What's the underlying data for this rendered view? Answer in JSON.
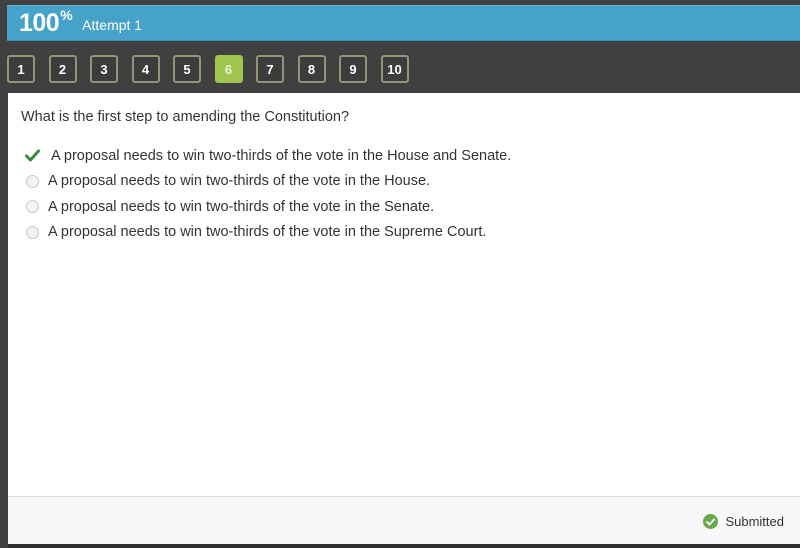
{
  "header": {
    "score_value": "100",
    "score_unit": "%",
    "attempt_label": "Attempt 1"
  },
  "navigation": {
    "questions": [
      {
        "label": "1",
        "active": false
      },
      {
        "label": "2",
        "active": false
      },
      {
        "label": "3",
        "active": false
      },
      {
        "label": "4",
        "active": false
      },
      {
        "label": "5",
        "active": false
      },
      {
        "label": "6",
        "active": true
      },
      {
        "label": "7",
        "active": false
      },
      {
        "label": "8",
        "active": false
      },
      {
        "label": "9",
        "active": false
      },
      {
        "label": "10",
        "active": false
      }
    ]
  },
  "question": {
    "prompt": "What is the first step to amending the Constitution?",
    "answers": [
      {
        "text": "A proposal needs to win two-thirds of the vote in the House and Senate.",
        "state": "correct",
        "icon": "checkmark-icon"
      },
      {
        "text": "A proposal needs to win two-thirds of the vote in the House.",
        "state": "unselected",
        "icon": "radio-icon"
      },
      {
        "text": "A proposal needs to win two-thirds of the vote in the Senate.",
        "state": "unselected",
        "icon": "radio-icon"
      },
      {
        "text": "A proposal needs to win two-thirds of the vote in the Supreme Court.",
        "state": "unselected",
        "icon": "radio-icon"
      }
    ]
  },
  "footer": {
    "status_label": "Submitted",
    "status_icon": "check-circle-icon"
  },
  "colors": {
    "score_bar": "#46a2c9",
    "active_question": "#9fc54f",
    "correct_check": "#3a8a3a",
    "submitted_badge": "#6aa84f"
  }
}
